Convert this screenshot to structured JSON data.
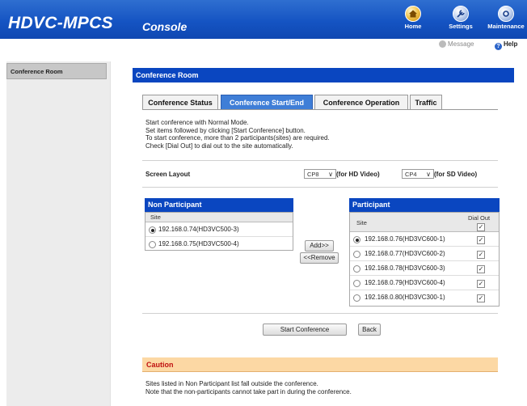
{
  "header": {
    "logo": "HDVC-MPCS",
    "section": "Console",
    "buttons": {
      "home": "Home",
      "settings": "Settings",
      "maintenance": "Maintenance"
    },
    "message": "Message",
    "help": "Help"
  },
  "sidebar": {
    "items": [
      {
        "label": "Conference Room"
      }
    ]
  },
  "main": {
    "title": "Conference Room",
    "tabs": [
      {
        "label": "Conference Status",
        "active": false
      },
      {
        "label": "Conference Start/End",
        "active": true
      },
      {
        "label": "Conference Operation",
        "active": false
      },
      {
        "label": "Traffic",
        "active": false
      }
    ],
    "description": [
      "Start conference with Normal Mode.",
      "Set items followed by clicking [Start Conference] button.",
      "To start conference, more than 2 participants(sites) are required.",
      "Check [Dial Out] to dial out to the site automatically."
    ],
    "screen_layout": {
      "label": "Screen Layout",
      "hd_value": "CP8",
      "hd_note": "(for HD Video)",
      "sd_value": "CP4",
      "sd_note": "(for SD Video)"
    },
    "non_participant": {
      "title": "Non Participant",
      "col_site": "Site",
      "rows": [
        {
          "site": "192.168.0.74(HD3VC500-3)",
          "selected": true
        },
        {
          "site": "192.168.0.75(HD3VC500-4)",
          "selected": false
        }
      ]
    },
    "add_button": "Add>>",
    "remove_button": "<<Remove",
    "participant": {
      "title": "Participant",
      "col_site": "Site",
      "col_dialout": "Dial Out",
      "rows": [
        {
          "site": "192.168.0.76(HD3VC600-1)",
          "selected": true,
          "dial_out": true
        },
        {
          "site": "192.168.0.77(HD3VC600-2)",
          "selected": false,
          "dial_out": true
        },
        {
          "site": "192.168.0.78(HD3VC600-3)",
          "selected": false,
          "dial_out": true
        },
        {
          "site": "192.168.0.79(HD3VC600-4)",
          "selected": false,
          "dial_out": true
        },
        {
          "site": "192.168.0.80(HD3VC300-1)",
          "selected": false,
          "dial_out": true
        }
      ]
    },
    "start_button": "Start Conference",
    "back_button": "Back",
    "caution_title": "Caution",
    "caution_lines": [
      "Sites listed in Non Participant list fall outside the conference.",
      "Note that the non-participants cannot take part in during the conference."
    ]
  },
  "colors": {
    "header_blue": "#1554c3",
    "panel_blue": "#0a46c0",
    "caution_bg": "#fcd8a4",
    "caution_text": "#c01010"
  }
}
